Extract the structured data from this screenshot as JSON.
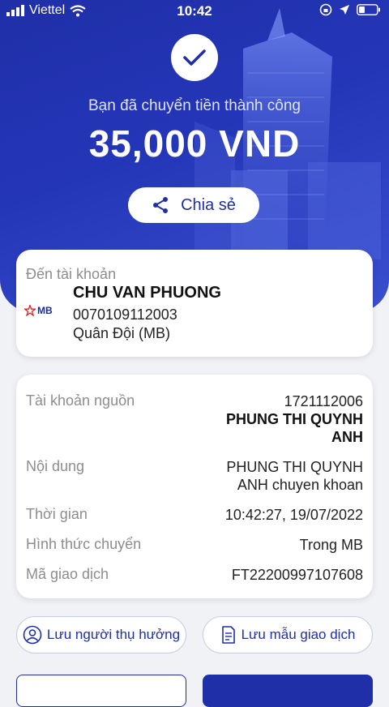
{
  "status_bar": {
    "carrier": "Viettel",
    "time": "10:42"
  },
  "result": {
    "message": "Bạn đã chuyển tiền thành công",
    "amount": "35,000 VND",
    "share_label": "Chia sẻ"
  },
  "destination": {
    "caption": "Đến tài khoản",
    "bank_logo_text": "MB",
    "name": "CHU VAN PHUONG",
    "account_number": "0070109112003",
    "bank_name": "Quân Đội (MB)"
  },
  "details": {
    "source_label": "Tài khoản nguồn",
    "source_account": "1721112006",
    "source_name_line1": "PHUNG THI QUYNH",
    "source_name_line2": "ANH",
    "content_label": "Nội dung",
    "content_line1": "PHUNG THI QUYNH",
    "content_line2": "ANH chuyen khoan",
    "time_label": "Thời gian",
    "time_value": "10:42:27, 19/07/2022",
    "method_label": "Hình thức chuyển",
    "method_value": "Trong MB",
    "txn_label": "Mã giao dịch",
    "txn_value": "FT22200997107608"
  },
  "actions": {
    "save_beneficiary": "Lưu người thụ hưởng",
    "save_template": "Lưu mẫu giao dịch"
  },
  "colors": {
    "brand": "#1f2fa8",
    "hero_start": "#1f2fa8",
    "hero_end": "#3a4fd0"
  }
}
